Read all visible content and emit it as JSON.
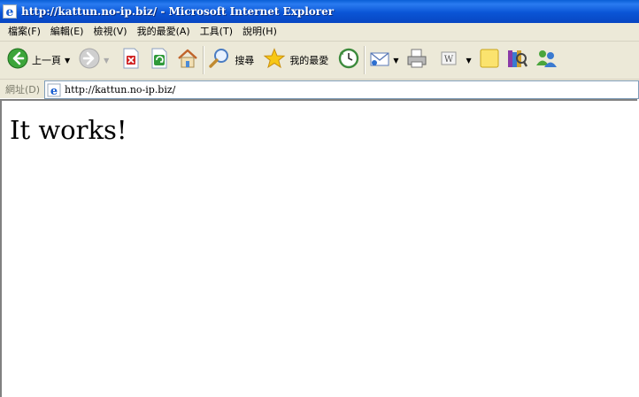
{
  "window": {
    "title": "http://kattun.no-ip.biz/ - Microsoft Internet Explorer"
  },
  "menu": [
    "檔案(F)",
    "編輯(E)",
    "檢視(V)",
    "我的最愛(A)",
    "工具(T)",
    "說明(H)"
  ],
  "toolbar": {
    "back_label": "上一頁",
    "search_label": "搜尋",
    "favorites_label": "我的最愛"
  },
  "address": {
    "label": "網址(D)",
    "url": "http://kattun.no-ip.biz/"
  },
  "page": {
    "heading": "It works!"
  },
  "colors": {
    "titlebar": "#0a55d6",
    "chrome": "#ece9d8",
    "address_border": "#7f9db9"
  }
}
